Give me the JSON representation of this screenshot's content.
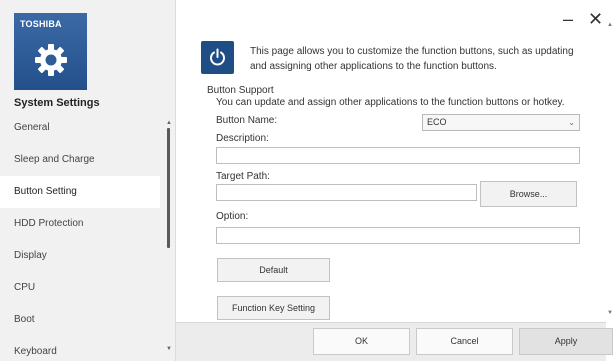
{
  "brand": {
    "logo_text": "TOSHIBA",
    "tile_color": "#2c5d98",
    "icon": "gear-icon"
  },
  "app": {
    "title": "System Settings"
  },
  "window": {
    "minimize_symbol": "–",
    "close_symbol": "✕"
  },
  "sidebar": {
    "items": [
      {
        "label": "General",
        "selected": false
      },
      {
        "label": "Sleep and Charge",
        "selected": false
      },
      {
        "label": "Button Setting",
        "selected": true
      },
      {
        "label": "HDD Protection",
        "selected": false
      },
      {
        "label": "Display",
        "selected": false
      },
      {
        "label": "CPU",
        "selected": false
      },
      {
        "label": "Boot",
        "selected": false
      },
      {
        "label": "Keyboard",
        "selected": false
      }
    ]
  },
  "intro": {
    "icon": "power-icon",
    "text": "This page allows you to customize the function buttons, such as updating and assigning other applications to the function buttons."
  },
  "button_support": {
    "title": "Button Support",
    "description": "You can update and assign other applications to the function buttons or hotkey.",
    "button_name_label": "Button Name:",
    "button_name_value": "ECO",
    "description_label": "Description:",
    "description_value": "",
    "target_path_label": "Target Path:",
    "target_path_value": "",
    "browse_label": "Browse...",
    "option_label": "Option:",
    "option_value": "",
    "default_label": "Default",
    "function_key_label": "Function Key Setting"
  },
  "footer": {
    "ok_label": "OK",
    "cancel_label": "Cancel",
    "apply_label": "Apply"
  }
}
